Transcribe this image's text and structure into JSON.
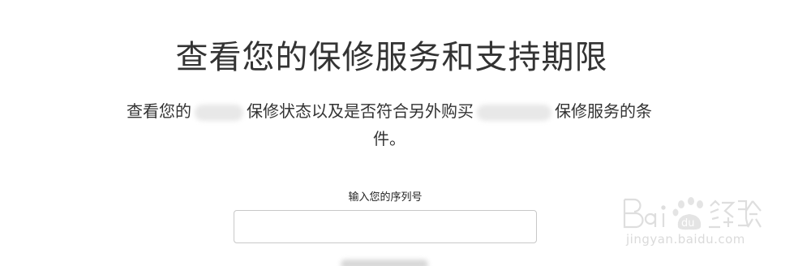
{
  "heading": {
    "title": "查看您的保修服务和支持期限"
  },
  "description": {
    "part1": "查看您的",
    "part2": "保修状态以及是否符合另外购买",
    "part3": "保修服务的条",
    "part4": "件。"
  },
  "serial_form": {
    "label": "输入您的序列号",
    "value": "",
    "placeholder": ""
  },
  "watermark": {
    "brand_text": "Bai du 经验",
    "url": "jingyan.baidu.com"
  },
  "colors": {
    "text": "#333333",
    "input_border": "#c8c8c8",
    "watermark": "#bcbcbc"
  }
}
